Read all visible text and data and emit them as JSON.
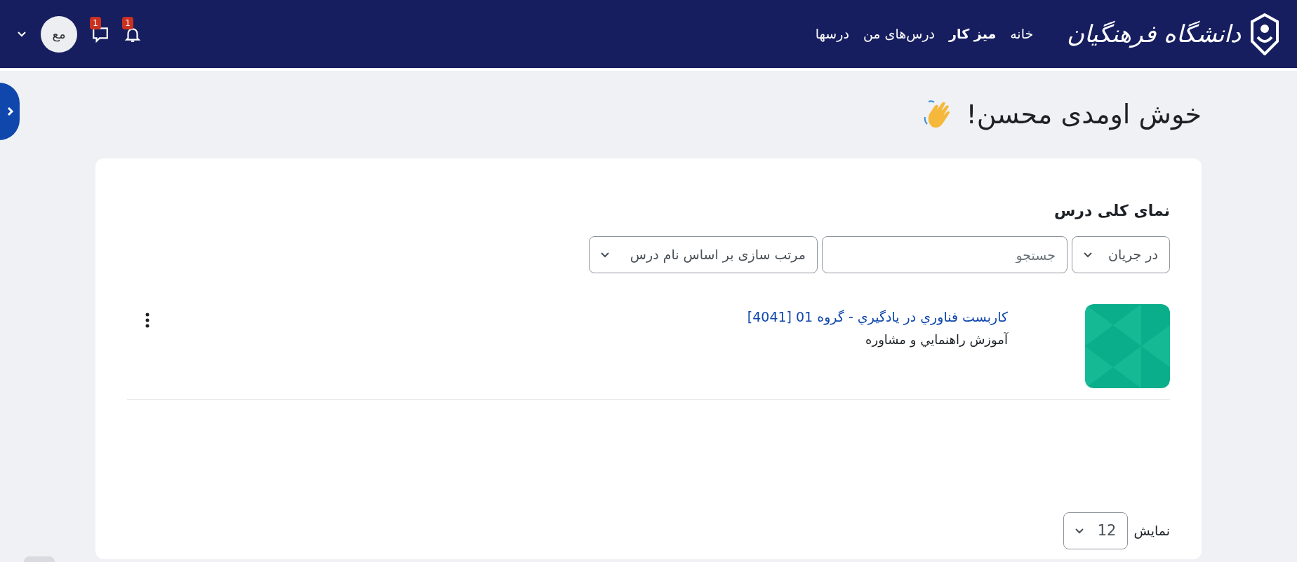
{
  "navbar": {
    "logo_text": "دانشگاه فرهنگیان",
    "links": [
      {
        "label": "خانه",
        "selected": false
      },
      {
        "label": "میز کار",
        "selected": true
      },
      {
        "label": "درس‌های من",
        "selected": false
      },
      {
        "label": "درسها",
        "selected": false
      }
    ],
    "notifications_count": "1",
    "messages_count": "1",
    "user_initials": "مع"
  },
  "greeting": "خوش اومدی محسن!",
  "course_overview": {
    "title": "نمای کلی درس",
    "status_filter": "در جریان",
    "search_placeholder": "جستجو",
    "sort": "مرتب سازی بر اساس نام درس",
    "courses": [
      {
        "name": "كاربست فناوري در يادگيري - گروه 01 [4041]",
        "category": "آموزش راهنمايي و مشاوره"
      }
    ],
    "per_page_label": "نمایش",
    "per_page": "12"
  }
}
